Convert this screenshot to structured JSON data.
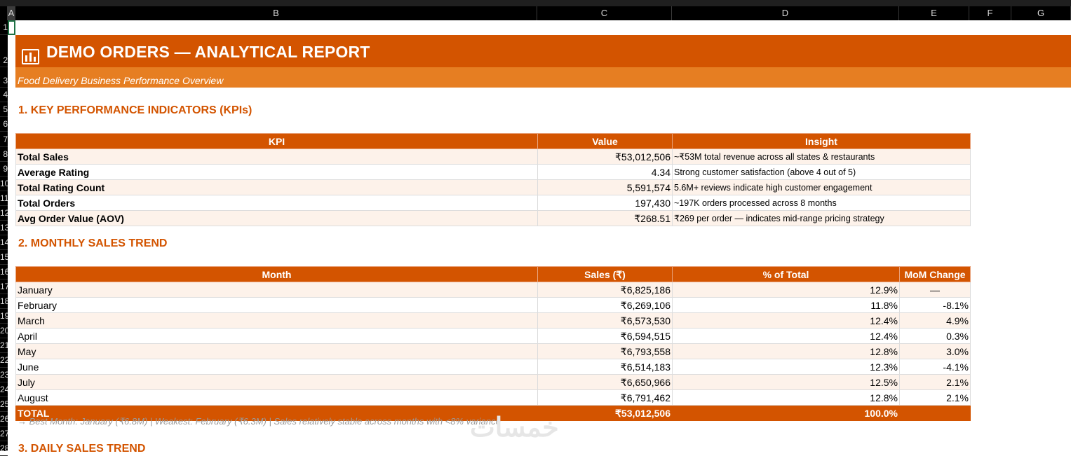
{
  "columns": [
    "A",
    "B",
    "C",
    "D",
    "E",
    "F",
    "G"
  ],
  "row_numbers": [
    "1",
    "2",
    "3",
    "4",
    "5",
    "6",
    "7",
    "8",
    "9",
    "10",
    "11",
    "12",
    "13",
    "14",
    "15",
    "16",
    "17",
    "18",
    "19",
    "20",
    "21",
    "22",
    "23",
    "24",
    "25",
    "26",
    "27",
    "28"
  ],
  "report": {
    "title": "DEMO ORDERS — ANALYTICAL REPORT",
    "subtitle": "Food Delivery Business Performance Overview",
    "icon": "bar-chart-icon",
    "brand_color": "#d35400",
    "accent_color": "#e67e22"
  },
  "kpi_section": {
    "heading": "1. KEY PERFORMANCE INDICATORS (KPIs)",
    "headers": [
      "KPI",
      "Value",
      "Insight"
    ],
    "rows": [
      {
        "kpi": "Total Sales",
        "value": "₹53,012,506",
        "insight": "~₹53M total revenue across all states & restaurants"
      },
      {
        "kpi": "Average Rating",
        "value": "4.34",
        "insight": "Strong customer satisfaction (above 4 out of 5)"
      },
      {
        "kpi": "Total Rating Count",
        "value": "5,591,574",
        "insight": "5.6M+ reviews indicate high customer engagement"
      },
      {
        "kpi": "Total Orders",
        "value": "197,430",
        "insight": "~197K orders processed across 8 months"
      },
      {
        "kpi": "Avg Order Value (AOV)",
        "value": "₹268.51",
        "insight": "₹269 per order — indicates mid-range pricing strategy"
      }
    ]
  },
  "monthly_section": {
    "heading": "2. MONTHLY SALES TREND",
    "headers": [
      "Month",
      "Sales (₹)",
      "% of Total",
      "MoM Change"
    ],
    "rows": [
      {
        "month": "January",
        "sales": "₹6,825,186",
        "pct": "12.9%",
        "mom": "—"
      },
      {
        "month": "February",
        "sales": "₹6,269,106",
        "pct": "11.8%",
        "mom": "-8.1%"
      },
      {
        "month": "March",
        "sales": "₹6,573,530",
        "pct": "12.4%",
        "mom": "4.9%"
      },
      {
        "month": "April",
        "sales": "₹6,594,515",
        "pct": "12.4%",
        "mom": "0.3%"
      },
      {
        "month": "May",
        "sales": "₹6,793,558",
        "pct": "12.8%",
        "mom": "3.0%"
      },
      {
        "month": "June",
        "sales": "₹6,514,183",
        "pct": "12.3%",
        "mom": "-4.1%"
      },
      {
        "month": "July",
        "sales": "₹6,650,966",
        "pct": "12.5%",
        "mom": "2.1%"
      },
      {
        "month": "August",
        "sales": "₹6,791,462",
        "pct": "12.8%",
        "mom": "2.1%"
      }
    ],
    "total": {
      "label": "TOTAL",
      "sales": "₹53,012,506",
      "pct": "100.0%",
      "mom": ""
    },
    "note": "→ Best Month: January (₹6.8M) | Weakest: February (₹6.3M) | Sales relatively stable across months with <8% variance"
  },
  "daily_section": {
    "heading": "3. DAILY SALES TREND"
  },
  "watermark": "خمسات"
}
